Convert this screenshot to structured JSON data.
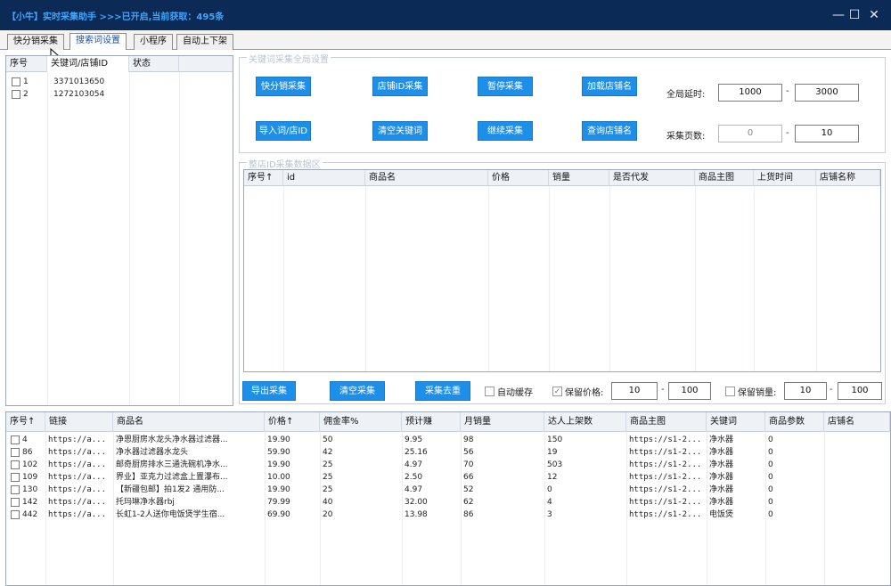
{
  "window": {
    "title": "【小牛】实时采集助手 >>>已开启,当前获取：495条",
    "controls": {
      "minimize": "—",
      "maximize": "☐",
      "close": "✕"
    }
  },
  "tabs": [
    {
      "label": "快分销采集"
    },
    {
      "label": "搜索词设置"
    },
    {
      "label": "小程序"
    },
    {
      "label": "自动上下架"
    }
  ],
  "keywords_table": {
    "headers": [
      "序号",
      "关键词/店铺ID",
      "状态"
    ],
    "rows": [
      {
        "index": "1",
        "keyword": "3371013650",
        "status": ""
      },
      {
        "index": "2",
        "keyword": "1272103054",
        "status": ""
      }
    ]
  },
  "global_settings": {
    "legend": "关键词采集全局设置",
    "buttons": {
      "quick_dist": "快分销采集",
      "shop_id_collect": "店铺ID采集",
      "pause": "暂停采集",
      "load_shop": "加载店铺名",
      "import": "导入词/店ID",
      "clear_keywords": "清空关键词",
      "resume": "继续采集",
      "query_shop": "查询店铺名"
    },
    "delay_label": "全局延时:",
    "delay_min": "1000",
    "delay_max": "3000",
    "pages_label": "采集页数:",
    "pages_min": "0",
    "pages_max": "10",
    "dash": "-"
  },
  "shop_data": {
    "legend": "整店ID采集数据区",
    "headers": [
      "序号↑",
      "id",
      "商品名",
      "价格",
      "销量",
      "是否代发",
      "商品主图",
      "上货时间",
      "店铺名称"
    ]
  },
  "controls": {
    "export": "导出采集",
    "clear": "清空采集",
    "dedupe": "采集去重",
    "auto_cache": "自动缓存",
    "keep_price": "保留价格:",
    "price_min": "10",
    "price_max": "100",
    "keep_sales": "保留销量:",
    "sales_min": "10",
    "sales_max": "100",
    "check": "✓"
  },
  "results_table": {
    "headers": [
      "序号↑",
      "链接",
      "商品名",
      "价格↑",
      "佣金率%",
      "预计赚",
      "月销量",
      "达人上架数",
      "商品主图",
      "关键词",
      "商品参数",
      "店铺名"
    ],
    "rows": [
      [
        "4",
        "https://a...",
        "净恩厨房水龙头净水器过滤器...",
        "19.90",
        "50",
        "9.95",
        "98",
        "150",
        "https://s1-2...",
        "净水器",
        "0",
        ""
      ],
      [
        "86",
        "https://a...",
        "净水器过滤器水龙头",
        "59.90",
        "42",
        "25.16",
        "56",
        "19",
        "https://s1-2...",
        "净水器",
        "0",
        ""
      ],
      [
        "102",
        "https://a...",
        "邮奇厨房排水三通洗碗机净水...",
        "19.90",
        "25",
        "4.97",
        "70",
        "503",
        "https://s1-2...",
        "净水器",
        "0",
        ""
      ],
      [
        "109",
        "https://a...",
        "界业】亚克力过滤盒上置瀑布...",
        "10.00",
        "25",
        "2.50",
        "66",
        "12",
        "https://s1-2...",
        "净水器",
        "0",
        ""
      ],
      [
        "130",
        "https://a...",
        "【新疆包邮】拍1发2 通用防...",
        "19.90",
        "25",
        "4.97",
        "52",
        "0",
        "https://s1-2...",
        "净水器",
        "0",
        ""
      ],
      [
        "142",
        "https://a...",
        "托玛琳净水器rbj",
        "79.99",
        "40",
        "32.00",
        "62",
        "4",
        "https://s1-2...",
        "净水器",
        "0",
        ""
      ],
      [
        "442",
        "https://a...",
        "长虹1-2人送你电饭煲学生宿...",
        "69.90",
        "20",
        "13.98",
        "86",
        "3",
        "https://s1-2...",
        "电饭煲",
        "0",
        ""
      ]
    ]
  }
}
